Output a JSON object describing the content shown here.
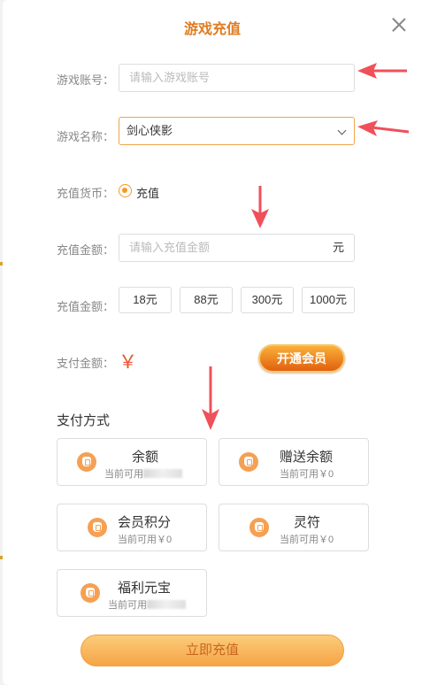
{
  "dialog": {
    "title": "游戏充值"
  },
  "form": {
    "account_label": "游戏账号：",
    "account_placeholder": "请输入游戏账号",
    "game_label": "游戏名称：",
    "game_value": "剑心侠影",
    "currency_label": "充值货币：",
    "currency_option": "充值",
    "amount_label": "充值金额：",
    "amount_placeholder": "请输入充值金额",
    "amount_unit": "元",
    "preset_label": "充值金额：",
    "presets": [
      "18元",
      "88元",
      "300元",
      "1000元"
    ],
    "pay_label": "支付金额：",
    "pay_symbol": "￥",
    "vip_button": "开通会员"
  },
  "payment": {
    "section_title": "支付方式",
    "methods": [
      {
        "name": "余额",
        "sub": "当前可用"
      },
      {
        "name": "赠送余额",
        "sub": "当前可用￥0"
      },
      {
        "name": "会员积分",
        "sub": "当前可用￥0"
      },
      {
        "name": "灵符",
        "sub": "当前可用￥0"
      },
      {
        "name": "福利元宝",
        "sub": "当前可用"
      }
    ]
  },
  "submit_label": "立即充值",
  "colors": {
    "accent": "#f59a23",
    "arrow": "#f0505a",
    "title": "#e07b1f"
  }
}
